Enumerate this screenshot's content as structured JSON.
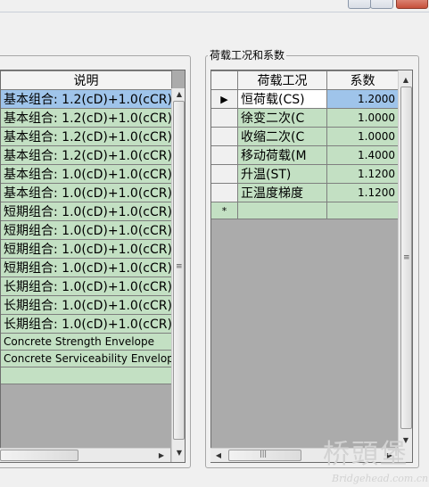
{
  "left_table": {
    "header": "说明",
    "rows": [
      {
        "text": "基本组合: 1.2(cD)+1.0(cCR)+",
        "selected": true
      },
      {
        "text": "基本组合: 1.2(cD)+1.0(cCR)+"
      },
      {
        "text": "基本组合: 1.2(cD)+1.0(cCR)+"
      },
      {
        "text": "基本组合: 1.2(cD)+1.0(cCR)+"
      },
      {
        "text": "基本组合: 1.0(cD)+1.0(cCR)+"
      },
      {
        "text": "基本组合: 1.0(cD)+1.0(cCR)+"
      },
      {
        "text": "短期组合: 1.0(cD)+1.0(cCR)+"
      },
      {
        "text": "短期组合: 1.0(cD)+1.0(cCR)+"
      },
      {
        "text": "短期组合: 1.0(cD)+1.0(cCR)+"
      },
      {
        "text": "短期组合: 1.0(cD)+1.0(cCR)+"
      },
      {
        "text": "长期组合: 1.0(cD)+1.0(cCR)+"
      },
      {
        "text": "长期组合: 1.0(cD)+1.0(cCR)+"
      },
      {
        "text": "长期组合: 1.0(cD)+1.0(cCR)+"
      },
      {
        "text": "Concrete Strength Envelope"
      },
      {
        "text": "Concrete Serviceability Envelop"
      },
      {
        "text": ""
      }
    ]
  },
  "right_group": {
    "title": "荷载工况和系数",
    "columns": [
      "荷载工况",
      "系数"
    ],
    "rows": [
      {
        "case": "恒荷载(CS)",
        "factor": "1.2000",
        "indicator": "▶",
        "selected": true
      },
      {
        "case": "徐变二次(C",
        "factor": "1.0000",
        "indicator": ""
      },
      {
        "case": "收缩二次(C",
        "factor": "1.0000",
        "indicator": ""
      },
      {
        "case": "移动荷载(M",
        "factor": "1.4000",
        "indicator": ""
      },
      {
        "case": "升温(ST)",
        "factor": "1.1200",
        "indicator": ""
      },
      {
        "case": "正温度梯度",
        "factor": "1.1200",
        "indicator": ""
      }
    ],
    "new_row_indicator": "*"
  },
  "scroll": {
    "up": "▲",
    "down": "▼",
    "left": "◀",
    "right": "▶",
    "grip": "≡",
    "hgrip": "|||"
  },
  "watermark": {
    "chinese": "桥頭堡",
    "url": "Bridgehead.com.cn"
  }
}
